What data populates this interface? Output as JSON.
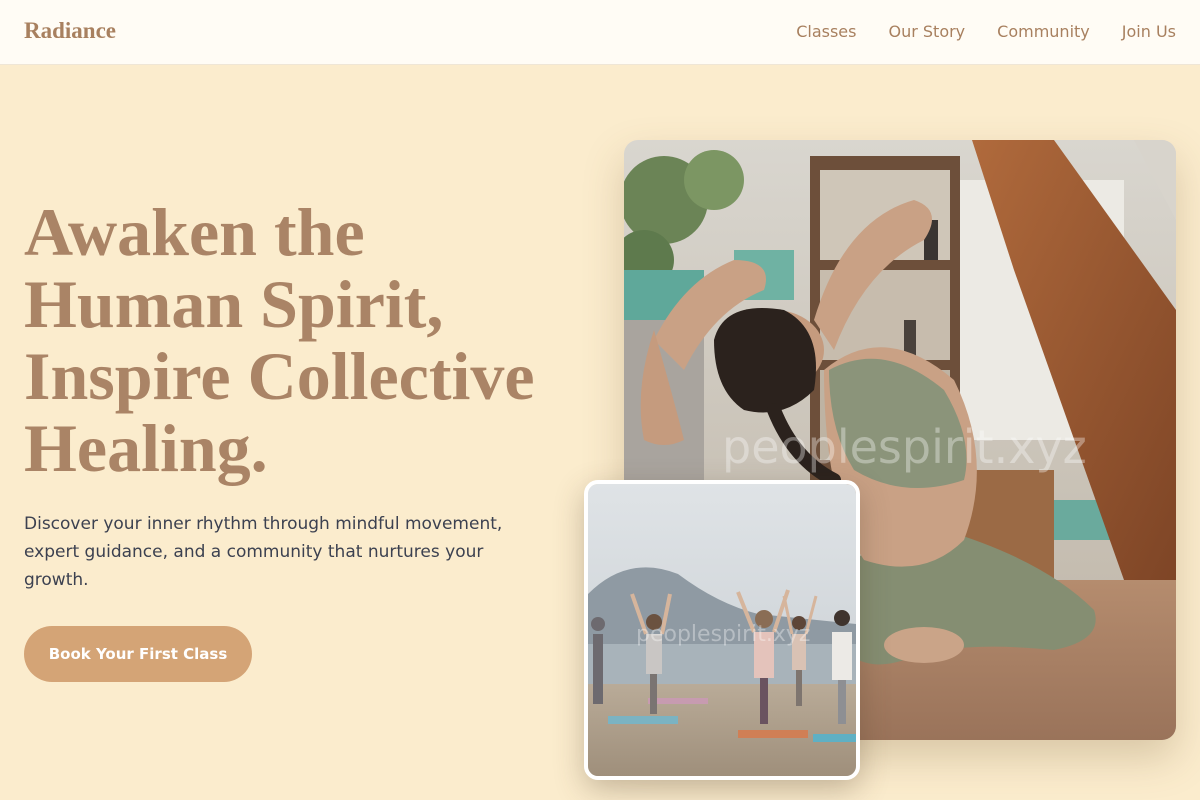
{
  "brand": {
    "name": "Radiance"
  },
  "nav": {
    "items": [
      {
        "label": "Classes"
      },
      {
        "label": "Our Story"
      },
      {
        "label": "Community"
      },
      {
        "label": "Join Us"
      }
    ]
  },
  "hero": {
    "title_lines": [
      "Awaken the",
      "Human Spirit,",
      "Inspire Collective",
      "Healing."
    ],
    "description": "Discover your inner rhythm through mindful movement, expert guidance, and a community that nurtures your growth.",
    "cta_label": "Book Your First Class"
  },
  "images": {
    "main": {
      "subject": "woman-backbend-yoga-pose",
      "watermark": "peoplespirit.xyz"
    },
    "secondary": {
      "subject": "group-tree-pose-on-beach",
      "watermark": "peoplespirit.xyz"
    }
  },
  "colors": {
    "page_background": "#fbeccd",
    "nav_background": "#fffcf5",
    "brand_accent": "#a8805f",
    "cta_background": "#d4a476",
    "body_text": "#3c4150"
  }
}
